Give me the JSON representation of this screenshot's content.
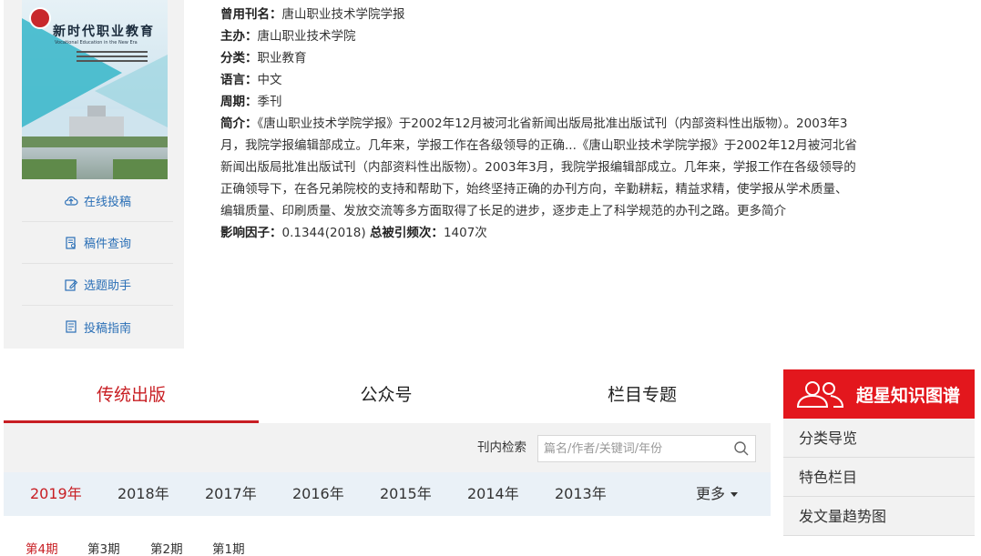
{
  "cover": {
    "title": "新时代职业教育",
    "subtitle": "Vocational Education in the New Era"
  },
  "side_links": [
    {
      "label": "在线投稿",
      "icon": "cloud-upload-icon"
    },
    {
      "label": "稿件查询",
      "icon": "document-search-icon"
    },
    {
      "label": "选题助手",
      "icon": "edit-icon"
    },
    {
      "label": "投稿指南",
      "icon": "guide-icon"
    }
  ],
  "info": {
    "former_name_label": "曾用刊名：",
    "former_name": "唐山职业技术学院学报",
    "sponsor_label": "主办：",
    "sponsor": "唐山职业技术学院",
    "category_label": "分类：",
    "category": "职业教育",
    "language_label": "语言：",
    "language": "中文",
    "period_label": "周期：",
    "period": "季刊",
    "intro_label": "简介：",
    "intro": "《唐山职业技术学院学报》于2002年12月被河北省新闻出版局批准出版试刊（内部资料性出版物）。2003年3月，我院学报编辑部成立。几年来，学报工作在各级领导的正确...《唐山职业技术学院学报》于2002年12月被河北省新闻出版局批准出版试刊（内部资料性出版物）。2003年3月，我院学报编辑部成立。几年来，学报工作在各级领导的正确领导下，在各兄弟院校的支持和帮助下，始终坚持正确的办刊方向，辛勤耕耘，精益求精，使学报从学术质量、编辑质量、印刷质量、发放交流等多方面取得了长足的进步，逐步走上了科学规范的办刊之路。",
    "more_intro": "更多简介",
    "impact_label": "影响因子：",
    "impact": "0.1344(2018)",
    "citations_label": "总被引频次：",
    "citations": "1407次"
  },
  "tabs": [
    "传统出版",
    "公众号",
    "栏目专题"
  ],
  "search": {
    "label": "刊内检索",
    "placeholder": "篇名/作者/关键词/年份"
  },
  "years": [
    "2019年",
    "2018年",
    "2017年",
    "2016年",
    "2015年",
    "2014年",
    "2013年"
  ],
  "years_more": "更多",
  "issues": [
    "第4期",
    "第3期",
    "第2期",
    "第1期"
  ],
  "right": {
    "brand": "超星知识图谱",
    "items": [
      "分类导览",
      "特色栏目",
      "发文量趋势图"
    ]
  },
  "colors": {
    "accent": "#c81e23",
    "brand_red": "#e3171d",
    "link_blue": "#2a6fb6"
  }
}
